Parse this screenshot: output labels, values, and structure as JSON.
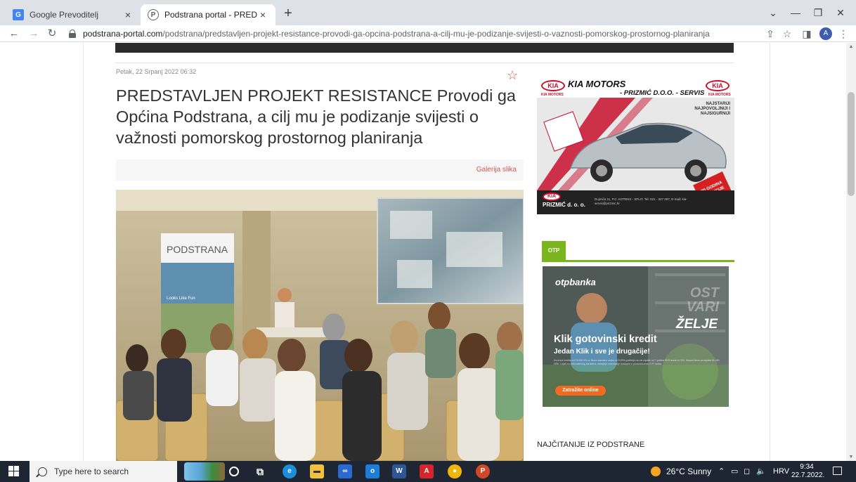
{
  "browser": {
    "tabs": [
      {
        "title": "Google Prevoditelj",
        "close": "×"
      },
      {
        "title": "Podstrana portal - PREDSTAVLJEN",
        "close": "×"
      }
    ],
    "new_tab": "+",
    "url_domain": "podstrana-portal.com",
    "url_path": "/podstrana/predstavljen-projekt-resistance-provodi-ga-opcina-podstrana-a-cilj-mu-je-podizanje-svijesti-o-vaznosti-pomorskog-prostornog-planiranja",
    "profile_initial": "A"
  },
  "article": {
    "date": "Petak, 22 Srpanj 2022 06:32",
    "headline": "PREDSTAVLJEN PROJEKT RESISTANCE Provodi ga Općina Podstrana, a cilj mu je podizanje svijesti o važnosti pomorskog prostornog planiranja",
    "gallery_link": "Galerija slika",
    "photo": {
      "banner_title": "PODSTRANA",
      "banner_tagline": "Looks Like Fun"
    }
  },
  "sidebar": {
    "kia_ad": {
      "logo": "KIA",
      "brand": "KIA MOTORS",
      "dealer": "- PRIZMIĆ D.O.O. - SERVIS",
      "tag": "KIA MOTORS",
      "slogan": "NAJSTARIJI NAJPOVOLJNIJI I NAJSIGURNIJI",
      "badge": "20 GODINA TRADICIJE",
      "bottom_brand": "PRIZMIĆ d. o. o.",
      "address": "Dujmića 11, P.C. KOTEKS - SPLIT. Tel: 021 - 347 297, E-mail: kia-servis@prizmic.hr"
    },
    "otp_section": {
      "tab_label": "OTP",
      "logo": "otpbanka",
      "ost": "OST VARI",
      "zelje": "ŽELJE",
      "title": "Klik gotovinski kredit",
      "subtitle": "Jedan Klik i sve je drugačije!",
      "fine_print": "Za iznos kredita od 75.000 KN uz fiksnu kamatnu stopu od 5,99% godišnje na rok otplate od 7 godina EKS iznosi 6,74%. Ukupni iznos za otplatu 91.000 HRK. Uvjeti su informativnog karaktera, detaljnije informacije dostupne u poslovnicama OTP banke.",
      "button": "Zatražite online"
    },
    "most_read_title": "NAJČITANIJE IZ PODSTRANE"
  },
  "taskbar": {
    "search_placeholder": "Type here to search",
    "weather": "26°C  Sunny",
    "language": "HRV",
    "time": "9:34",
    "date": "22.7.2022."
  }
}
